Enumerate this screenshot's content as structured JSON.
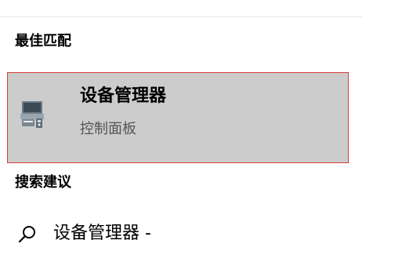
{
  "sections": {
    "best_match": "最佳匹配",
    "search_suggestions": "搜索建议"
  },
  "best_match_item": {
    "title": "设备管理器",
    "subtitle": "控制面板",
    "icon": "device-manager-icon"
  },
  "suggestion": {
    "text": "设备管理器 -",
    "icon": "search-icon"
  },
  "colors": {
    "selected_background": "#cccccc",
    "highlight_border": "#d93c3c",
    "subtitle_text": "#555555"
  }
}
